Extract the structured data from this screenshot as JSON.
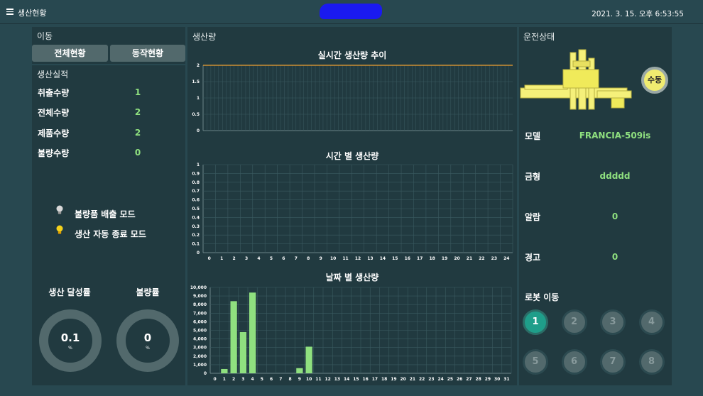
{
  "header": {
    "title": "생산현황",
    "clock": "2021. 3. 15. 오후 6:53:55"
  },
  "nav": {
    "title": "이동",
    "buttons": [
      "전체현황",
      "동작현황"
    ]
  },
  "production": {
    "title": "생산실적",
    "stats": [
      {
        "label": "취출수량",
        "value": "1"
      },
      {
        "label": "전체수량",
        "value": "2"
      },
      {
        "label": "제품수량",
        "value": "2"
      },
      {
        "label": "불량수량",
        "value": "0"
      }
    ],
    "modes": [
      {
        "label": "불량품 배출 모드",
        "state": "off"
      },
      {
        "label": "생산 자동 종료 모드",
        "state": "on"
      }
    ],
    "rates": [
      {
        "label": "생산 달성률",
        "value": "0.1",
        "unit": "%"
      },
      {
        "label": "불량률",
        "value": "0",
        "unit": "%"
      }
    ]
  },
  "output": {
    "title": "생산량",
    "chart_data": [
      {
        "type": "line",
        "title": "실시간 생산량 추이",
        "y_ticks": [
          "0",
          "0.5",
          "1",
          "1.5",
          "2"
        ],
        "ylim": [
          0,
          2
        ],
        "series": [
          {
            "values": [
              2,
              2
            ]
          }
        ],
        "line_color": "#f0a030",
        "grid": true
      },
      {
        "type": "bar",
        "title": "시간 별 생산량",
        "categories": [
          "0",
          "1",
          "2",
          "3",
          "4",
          "5",
          "6",
          "7",
          "8",
          "9",
          "10",
          "11",
          "12",
          "13",
          "14",
          "15",
          "16",
          "17",
          "18",
          "19",
          "20",
          "21",
          "22",
          "23",
          "24"
        ],
        "values": [
          0,
          0,
          0,
          0,
          0,
          0,
          0,
          0,
          0,
          0,
          0,
          0,
          0,
          0,
          0,
          0,
          0,
          0,
          0,
          0,
          0,
          0,
          0,
          0,
          0
        ],
        "y_ticks": [
          "0",
          "0.1",
          "0.2",
          "0.3",
          "0.4",
          "0.5",
          "0.6",
          "0.7",
          "0.8",
          "0.9",
          "1"
        ],
        "ylim": [
          0,
          1
        ],
        "grid": true
      },
      {
        "type": "bar",
        "title": "날짜 별 생산량",
        "categories": [
          "0",
          "1",
          "2",
          "3",
          "4",
          "5",
          "6",
          "7",
          "8",
          "9",
          "10",
          "11",
          "12",
          "13",
          "14",
          "15",
          "16",
          "17",
          "18",
          "19",
          "20",
          "21",
          "22",
          "23",
          "24",
          "25",
          "26",
          "27",
          "28",
          "29",
          "30",
          "31"
        ],
        "values": [
          0,
          500,
          8400,
          4800,
          9400,
          0,
          0,
          0,
          0,
          600,
          3100,
          0,
          0,
          0,
          0,
          0,
          0,
          0,
          0,
          0,
          0,
          0,
          0,
          0,
          0,
          0,
          0,
          0,
          0,
          0,
          0,
          0
        ],
        "y_ticks": [
          "0",
          "1,000",
          "2,000",
          "3,000",
          "4,000",
          "5,000",
          "6,000",
          "7,000",
          "8,000",
          "9,000",
          "10,000"
        ],
        "ylim": [
          0,
          10000
        ],
        "bar_color": "#8fe07f",
        "grid": true
      }
    ]
  },
  "status": {
    "title": "운전상태",
    "manual_label": "수동",
    "info": [
      {
        "label": "모델",
        "value": "FRANCIA-509is"
      },
      {
        "label": "금형",
        "value": "ddddd"
      },
      {
        "label": "알람",
        "value": "0"
      },
      {
        "label": "경고",
        "value": "0"
      }
    ],
    "robot": {
      "title": "로봇 이동",
      "buttons": [
        "1",
        "2",
        "3",
        "4",
        "5",
        "6",
        "7",
        "8"
      ],
      "active": "1"
    }
  },
  "colors": {
    "background": "#284850",
    "panel": "#213a40",
    "accent_green": "#8fe07f",
    "accent_orange": "#f0a030",
    "active_teal": "#1f9e8a"
  }
}
